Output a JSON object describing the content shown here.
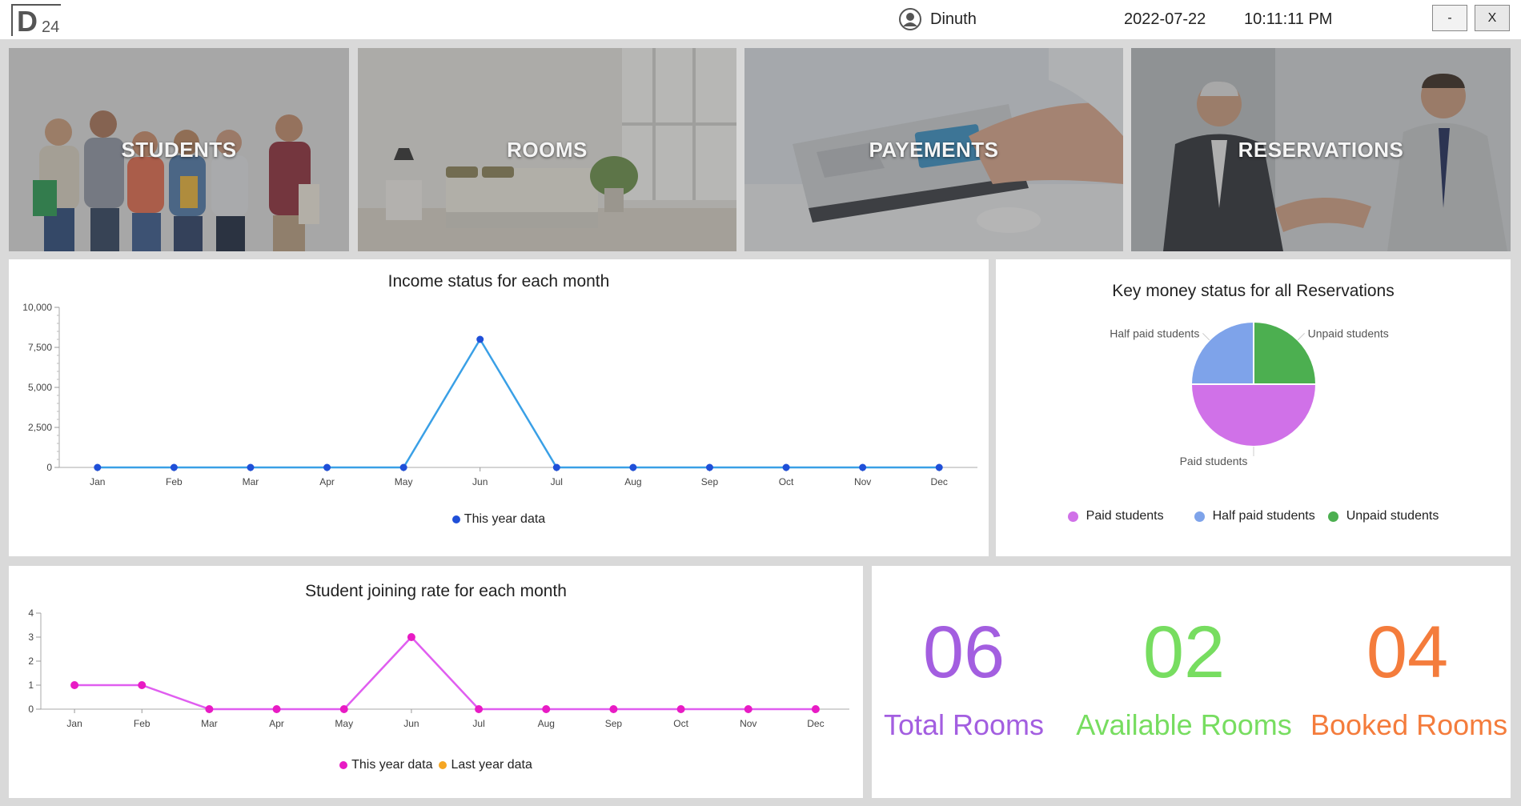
{
  "header": {
    "logo_main": "D",
    "logo_sub": "24",
    "user_name": "Dinuth",
    "date": "2022-07-22",
    "time": "10:11:11 PM",
    "minimize_label": "-",
    "close_label": "X"
  },
  "tiles": [
    {
      "label": "STUDENTS",
      "icon": "students-photo"
    },
    {
      "label": "ROOMS",
      "icon": "bedroom-photo"
    },
    {
      "label": "PAYEMENTS",
      "icon": "laptop-card-photo"
    },
    {
      "label": "RESERVATIONS",
      "icon": "handshake-photo"
    }
  ],
  "income_chart": {
    "title": "Income status for each month",
    "legend": "This year data"
  },
  "key_chart": {
    "title": "Key money status for all Reservations",
    "legend": [
      "Paid students",
      "Half paid students",
      "Unpaid students"
    ]
  },
  "join_chart": {
    "title": "Student joining rate for each month",
    "legend": [
      "This year data",
      "Last year data"
    ]
  },
  "rooms": {
    "total_value": "06",
    "total_label": "Total Rooms",
    "available_value": "02",
    "available_label": "Available Rooms",
    "booked_value": "04",
    "booked_label": "Booked Rooms"
  },
  "colors": {
    "income_line": "#3aa0e6",
    "income_point": "#1f4fd8",
    "join_line": "#e05ef0",
    "join_point": "#e81bc4",
    "last_year": "#f5a623",
    "paid": "#d071e8",
    "half_paid": "#7ea3ea",
    "unpaid": "#4caf50",
    "total": "#a35ee0",
    "available": "#77dd60",
    "booked": "#f47c3c"
  },
  "chart_data": [
    {
      "type": "line",
      "title": "Income status for each month",
      "categories": [
        "Jan",
        "Feb",
        "Mar",
        "Apr",
        "May",
        "Jun",
        "Jul",
        "Aug",
        "Sep",
        "Oct",
        "Nov",
        "Dec"
      ],
      "series": [
        {
          "name": "This year data",
          "values": [
            0,
            0,
            0,
            0,
            0,
            8000,
            0,
            0,
            0,
            0,
            0,
            0
          ]
        }
      ],
      "yticks": [
        "0",
        "2,500",
        "5,000",
        "7,500",
        "10,000"
      ],
      "ylim": [
        0,
        10000
      ],
      "grid": false,
      "legend": "bottom"
    },
    {
      "type": "pie",
      "title": "Key money status for all Reservations",
      "labels": [
        "Paid students",
        "Half paid students",
        "Unpaid students"
      ],
      "values": [
        2,
        1,
        1
      ],
      "legend": "bottom"
    },
    {
      "type": "line",
      "title": "Student joining rate for each month",
      "categories": [
        "Jan",
        "Feb",
        "Mar",
        "Apr",
        "May",
        "Jun",
        "Jul",
        "Aug",
        "Sep",
        "Oct",
        "Nov",
        "Dec"
      ],
      "series": [
        {
          "name": "This year data",
          "values": [
            1,
            1,
            0,
            0,
            0,
            3,
            0,
            0,
            0,
            0,
            0,
            0
          ]
        },
        {
          "name": "Last year data",
          "values": []
        }
      ],
      "yticks": [
        "0",
        "1",
        "2",
        "3",
        "4"
      ],
      "ylim": [
        0,
        4
      ],
      "grid": false,
      "legend": "bottom"
    }
  ]
}
